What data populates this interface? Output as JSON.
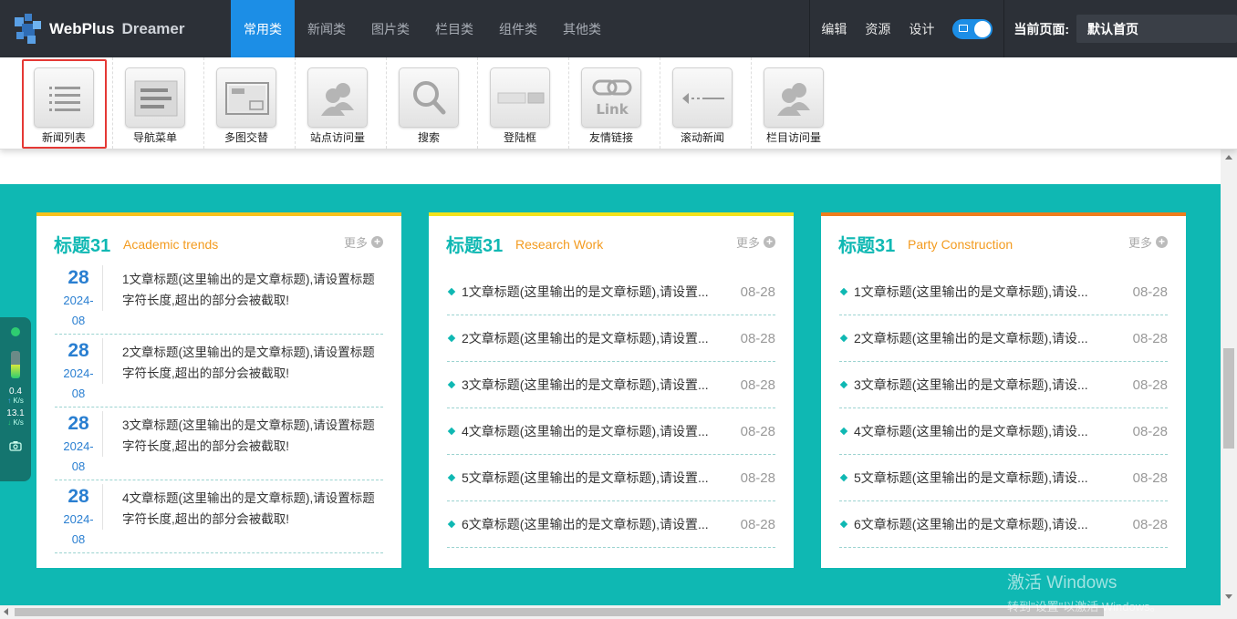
{
  "app": {
    "logo_primary": "WebPlus",
    "logo_secondary": "Dreamer"
  },
  "nav": [
    {
      "label": "常用类",
      "active": true
    },
    {
      "label": "新闻类",
      "active": false
    },
    {
      "label": "图片类",
      "active": false
    },
    {
      "label": "栏目类",
      "active": false
    },
    {
      "label": "组件类",
      "active": false
    },
    {
      "label": "其他类",
      "active": false
    }
  ],
  "tools": {
    "edit": "编辑",
    "resources": "资源",
    "design": "设计",
    "current_page_label": "当前页面:",
    "current_page_value": "默认首页"
  },
  "components": [
    {
      "label": "新闻列表",
      "icon": "news-list-icon",
      "selected": true
    },
    {
      "label": "导航菜单",
      "icon": "nav-menu-icon",
      "selected": false
    },
    {
      "label": "多图交替",
      "icon": "image-slider-icon",
      "selected": false
    },
    {
      "label": "站点访问量",
      "icon": "site-visits-icon",
      "selected": false
    },
    {
      "label": "搜索",
      "icon": "search-icon",
      "selected": false
    },
    {
      "label": "登陆框",
      "icon": "login-box-icon",
      "selected": false
    },
    {
      "label": "友情链接",
      "icon": "link-icon",
      "selected": false
    },
    {
      "label": "滚动新闻",
      "icon": "scroll-news-icon",
      "selected": false
    },
    {
      "label": "栏目访问量",
      "icon": "column-visits-icon",
      "selected": false
    }
  ],
  "panels": [
    {
      "title": "标题31",
      "subtitle": "Academic trends",
      "more": "更多",
      "accent": "#f7c21c",
      "dated_items": [
        {
          "day": "28",
          "year": "2024-",
          "month": "08",
          "text": "1文章标题(这里输出的是文章标题),请设置标题字符长度,超出的部分会被截取!"
        },
        {
          "day": "28",
          "year": "2024-",
          "month": "08",
          "text": "2文章标题(这里输出的是文章标题),请设置标题字符长度,超出的部分会被截取!"
        },
        {
          "day": "28",
          "year": "2024-",
          "month": "08",
          "text": "3文章标题(这里输出的是文章标题),请设置标题字符长度,超出的部分会被截取!"
        },
        {
          "day": "28",
          "year": "2024-",
          "month": "08",
          "text": "4文章标题(这里输出的是文章标题),请设置标题字符长度,超出的部分会被截取!"
        }
      ]
    },
    {
      "title": "标题31",
      "subtitle": "Research Work",
      "more": "更多",
      "accent": "#f2e21a",
      "items": [
        {
          "text": "1文章标题(这里输出的是文章标题),请设置...",
          "date": "08-28"
        },
        {
          "text": "2文章标题(这里输出的是文章标题),请设置...",
          "date": "08-28"
        },
        {
          "text": "3文章标题(这里输出的是文章标题),请设置...",
          "date": "08-28"
        },
        {
          "text": "4文章标题(这里输出的是文章标题),请设置...",
          "date": "08-28"
        },
        {
          "text": "5文章标题(这里输出的是文章标题),请设置...",
          "date": "08-28"
        },
        {
          "text": "6文章标题(这里输出的是文章标题),请设置...",
          "date": "08-28"
        }
      ]
    },
    {
      "title": "标题31",
      "subtitle": "Party Construction",
      "more": "更多",
      "accent": "#ee7d1c",
      "items": [
        {
          "text": "1文章标题(这里输出的是文章标题),请设...",
          "date": "08-28"
        },
        {
          "text": "2文章标题(这里输出的是文章标题),请设...",
          "date": "08-28"
        },
        {
          "text": "3文章标题(这里输出的是文章标题),请设...",
          "date": "08-28"
        },
        {
          "text": "4文章标题(这里输出的是文章标题),请设...",
          "date": "08-28"
        },
        {
          "text": "5文章标题(这里输出的是文章标题),请设...",
          "date": "08-28"
        },
        {
          "text": "6文章标题(这里输出的是文章标题),请设...",
          "date": "08-28"
        }
      ]
    }
  ],
  "net_widget": {
    "up_value": "0.4",
    "up_unit": "K/s",
    "down_value": "13.1",
    "down_unit": "K/s"
  },
  "watermark": {
    "line1": "激活 Windows",
    "line2": "转到\"设置\"以激活 Windows。"
  },
  "colors": {
    "topbar": "#2c3037",
    "active_nav": "#1c8ee6",
    "teal_background": "#0fb8b3",
    "title_teal": "#0fb8b3",
    "subtitle_orange": "#f39b1f",
    "date_blue": "#2a7fd1",
    "selection_red": "#e53935"
  }
}
